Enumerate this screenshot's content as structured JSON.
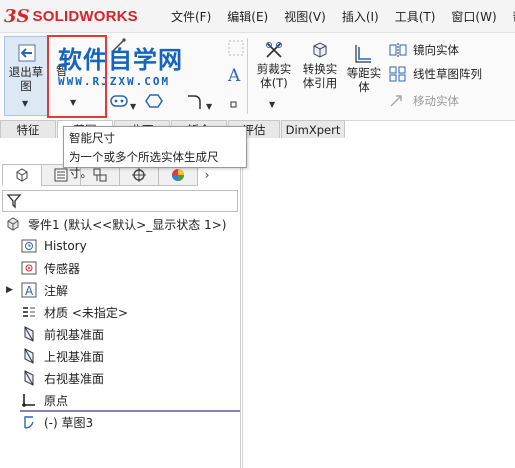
{
  "app": {
    "logo_ds": "3S",
    "logo_text": "SOLIDWORKS"
  },
  "menu": [
    "文件(F)",
    "编辑(E)",
    "视图(V)",
    "插入(I)",
    "工具(T)",
    "窗口(W)",
    "帮助"
  ],
  "ribbon": {
    "exit_sketch_line1": "退出草",
    "exit_sketch_line2": "图",
    "smart_dim_partial": "智",
    "trim_line1": "剪裁实",
    "trim_line2": "体(T)",
    "convert_line1": "转换实",
    "convert_line2": "体引用",
    "offset_line1": "等距实",
    "offset_line2": "体",
    "mirror": "镜向实体",
    "linear_pattern": "线性草图阵列",
    "move": "移动实体"
  },
  "watermark": {
    "cn": "软件自学网",
    "url": "WWW.RJZXW.COM"
  },
  "tabs": [
    "特征",
    "草图",
    "曲面",
    "钣金",
    "评估",
    "DimXpert"
  ],
  "tooltip": {
    "title": "智能尺寸",
    "desc": "为一个或多个所选实体生成尺寸。"
  },
  "tree": {
    "root": "零件1 (默认<<默认>_显示状态 1>)",
    "items": [
      "History",
      "传感器",
      "注解",
      "材质 <未指定>",
      "前视基准面",
      "上视基准面",
      "右视基准面",
      "原点",
      "(-) 草图3"
    ]
  },
  "colors": {
    "brand_red": "#d8232a",
    "watermark_blue": "#1565c0",
    "highlight_red": "#e53935",
    "rollback": "#8a7fb0"
  }
}
